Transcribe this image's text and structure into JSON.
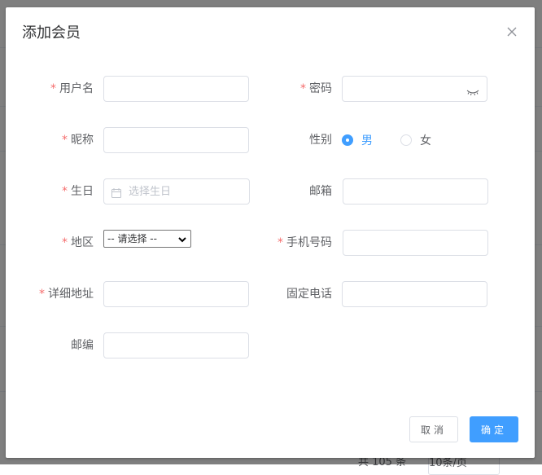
{
  "dialog": {
    "title": "添加会员",
    "close_icon": "close-icon"
  },
  "form": {
    "username": {
      "label": "用户名",
      "required": "*",
      "value": ""
    },
    "password": {
      "label": "密码",
      "required": "*",
      "value": "",
      "toggle_icon": "eye-closed-icon"
    },
    "nickname": {
      "label": "昵称",
      "required": "*",
      "value": ""
    },
    "gender": {
      "label": "性别",
      "options": [
        "男",
        "女"
      ],
      "selected": "男"
    },
    "birthday": {
      "label": "生日",
      "required": "*",
      "placeholder": "选择生日",
      "icon": "calendar-icon"
    },
    "email": {
      "label": "邮箱",
      "value": ""
    },
    "region": {
      "label": "地区",
      "required": "*",
      "selected": "-- 请选择 --"
    },
    "mobile": {
      "label": "手机号码",
      "required": "*",
      "value": ""
    },
    "address": {
      "label": "详细地址",
      "required": "*",
      "value": ""
    },
    "phone": {
      "label": "固定电话",
      "value": ""
    },
    "postcode": {
      "label": "邮编",
      "value": ""
    }
  },
  "footer": {
    "cancel_label": "取消",
    "ok_label": "确定"
  },
  "background": {
    "pager_total": "共 105 条",
    "pager_size": "10条/页"
  },
  "colors": {
    "primary": "#409eff",
    "required": "#f56c6c",
    "overlay": "rgba(0,0,0,0.5)"
  }
}
